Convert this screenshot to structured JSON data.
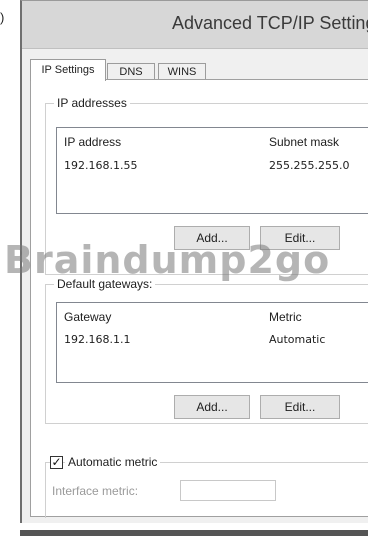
{
  "edge_label": ")",
  "window": {
    "title": "Advanced TCP/IP Setting"
  },
  "tabs": [
    {
      "label": "IP Settings",
      "active": true
    },
    {
      "label": "DNS",
      "active": false
    },
    {
      "label": "WINS",
      "active": false
    }
  ],
  "ip_addresses": {
    "group_title": "IP addresses",
    "columns": [
      "IP address",
      "Subnet mask"
    ],
    "rows": [
      {
        "ip": "192.168.1.55",
        "mask": "255.255.255.0"
      }
    ],
    "add_label": "Add...",
    "edit_label": "Edit..."
  },
  "watermark": "Braindump2go",
  "gateways": {
    "group_title": "Default gateways:",
    "columns": [
      "Gateway",
      "Metric"
    ],
    "rows": [
      {
        "gateway": "192.168.1.1",
        "metric": "Automatic"
      }
    ],
    "add_label": "Add...",
    "edit_label": "Edit..."
  },
  "automatic_metric": {
    "label": "Automatic metric",
    "checked": true,
    "check_glyph": "✓",
    "interface_metric_label": "Interface metric:",
    "interface_metric_value": ""
  }
}
